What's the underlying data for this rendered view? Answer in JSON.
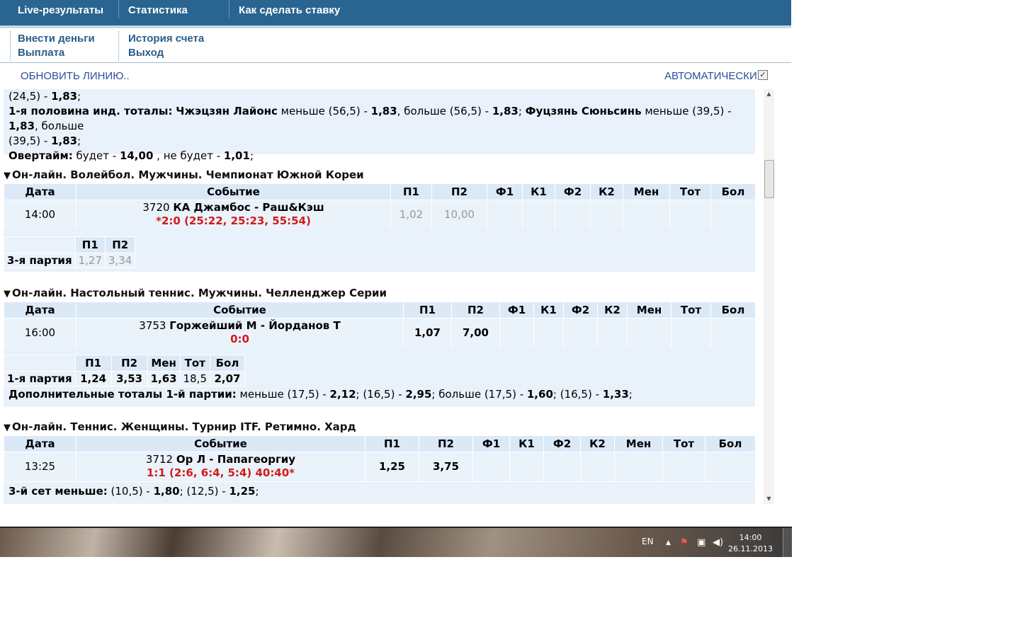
{
  "topnav": {
    "items": [
      "Live-результаты",
      "Статистика",
      "Как сделать ставку"
    ]
  },
  "subnav": {
    "deposit": "Внести деньги",
    "withdraw": "Выплата",
    "history": "История счета",
    "logout": "Выход"
  },
  "controls": {
    "refresh": "ОБНОВИТЬ ЛИНИЮ..",
    "auto": "АВТОМАТИЧЕСКИ",
    "auto_checked": true
  },
  "prev_block": {
    "line1_tail": "(24,5) - ",
    "line1_odd": "1,83",
    "line2_label": "1-я половина инд. тоталы:",
    "line2_team1": "Чжэцзян Лайонс",
    "line2_t1_less": " меньше (56,5) - ",
    "line2_t1_less_odd": "1,83",
    "line2_t1_more": ", больше (56,5) - ",
    "line2_t1_more_odd": "1,83",
    "line2_team2": "Фуцзянь Сюньсинь",
    "line2_t2_less": " меньше (39,5) - ",
    "line2_t2_less_odd": "1,83",
    "line2_t2_more": ", больше",
    "line3_text": "(39,5) - ",
    "line3_odd": "1,83",
    "ot_label": "Овертайм:",
    "ot_yes": " будет - ",
    "ot_yes_odd": "14,00",
    "ot_no": " , не будет - ",
    "ot_no_odd": "1,01"
  },
  "columns": [
    "Дата",
    "Событие",
    "П1",
    "П2",
    "Ф1",
    "К1",
    "Ф2",
    "К2",
    "Мен",
    "Тот",
    "Бол"
  ],
  "sections": [
    {
      "title": "Он-лайн. Волейбол. Мужчины. Чемпионат Южной Кореи",
      "time": "14:00",
      "num": "3720",
      "name": "КА Джамбос - Раш&Кэш",
      "score": "*2:0 (25:22, 25:23, 55:54)",
      "p1": "1,02",
      "p2": "10,00",
      "sub_headers": [
        "П1",
        "П2"
      ],
      "sub_label": "3-я партия",
      "sub_values": [
        "1,27",
        "3,34"
      ]
    },
    {
      "title": "Он-лайн. Настольный теннис. Мужчины. Челленджер Серии",
      "time": "16:00",
      "num": "3753",
      "name": "Горжейший М - Йорданов Т",
      "score": "0:0",
      "p1": "1,07",
      "p2": "7,00",
      "sub_headers": [
        "П1",
        "П2",
        "Мен",
        "Тот",
        "Бол"
      ],
      "sub_label": "1-я партия",
      "sub_values": [
        "1,24",
        "3,53",
        "1,63",
        "18,5",
        "2,07"
      ],
      "extra_label": "Дополнительные тоталы 1-й партии:",
      "extra_a": " меньше (17,5) - ",
      "extra_a_odd": "2,12",
      "extra_b": "; (16,5) - ",
      "extra_b_odd": "2,95",
      "extra_c": "; больше (17,5) - ",
      "extra_c_odd": "1,60",
      "extra_d": "; (16,5) - ",
      "extra_d_odd": "1,33",
      "extra_end": ";"
    },
    {
      "title": "Он-лайн. Теннис. Женщины. Турнир ITF. Ретимно. Хард",
      "time": "13:25",
      "num": "3712",
      "name": "Ор Л - Папагеоргиу",
      "score": "1:1 (2:6, 6:4, 5:4) 40:40*",
      "p1": "1,25",
      "p2": "3,75",
      "extra_label": "3-й сет меньше:",
      "extra_a": " (10,5) - ",
      "extra_a_odd": "1,80",
      "extra_b": "; (12,5) - ",
      "extra_b_odd": "1,25",
      "extra_end": ";"
    }
  ],
  "taskbar": {
    "lang": "EN",
    "time": "14:00",
    "date": "26.11.2013"
  }
}
